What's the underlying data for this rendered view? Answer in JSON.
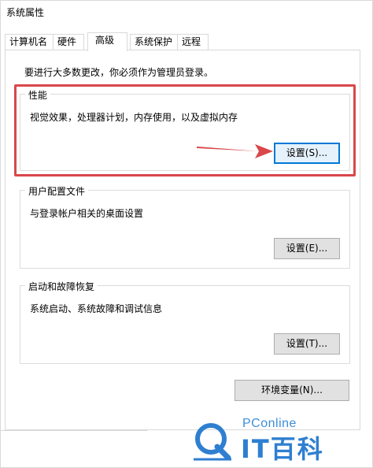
{
  "window": {
    "title": "系统属性"
  },
  "tabs": [
    {
      "label": "计算机名",
      "active": false
    },
    {
      "label": "硬件",
      "active": false
    },
    {
      "label": "高级",
      "active": true
    },
    {
      "label": "系统保护",
      "active": false
    },
    {
      "label": "远程",
      "active": false
    }
  ],
  "notice": "要进行大多数更改，你必须作为管理员登录。",
  "performance": {
    "legend": "性能",
    "description": "视觉效果，处理器计划，内存使用，以及虚拟内存",
    "button": "设置(S)..."
  },
  "user_profiles": {
    "legend": "用户配置文件",
    "description": "与登录帐户相关的桌面设置",
    "button": "设置(E)..."
  },
  "startup_recovery": {
    "legend": "启动和故障恢复",
    "description": "系统启动、系统故障和调试信息",
    "button": "设置(T)..."
  },
  "env_button": "环境变量(N)...",
  "colors": {
    "highlight": "#d9474b",
    "focus": "#0078d7",
    "watermark": "#2f7fd1"
  },
  "watermark": {
    "small": "PConline",
    "big": "IT百科"
  }
}
